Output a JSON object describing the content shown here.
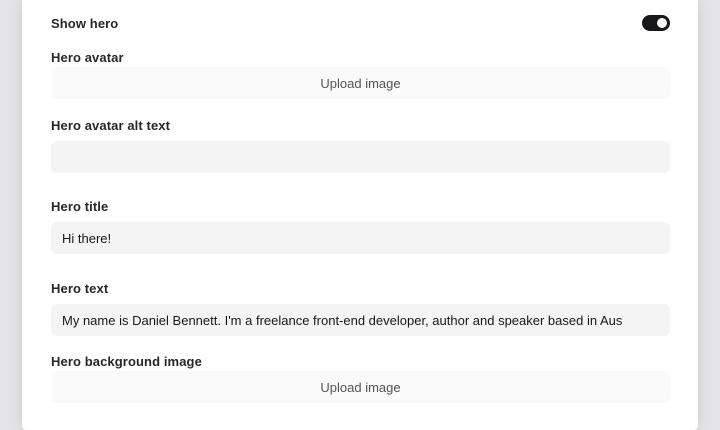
{
  "settings": {
    "show_hero": {
      "label": "Show hero",
      "enabled": true
    },
    "hero_avatar": {
      "label": "Hero avatar",
      "button_label": "Upload image"
    },
    "hero_avatar_alt": {
      "label": "Hero avatar alt text",
      "value": ""
    },
    "hero_title": {
      "label": "Hero title",
      "value": "Hi there!"
    },
    "hero_text": {
      "label": "Hero text",
      "value": "My name is Daniel Bennett. I'm a freelance front-end developer, author and speaker based in Aus"
    },
    "hero_background": {
      "label": "Hero background image",
      "button_label": "Upload image"
    }
  },
  "colors": {
    "toggle_on": "#18181b",
    "input_bg": "#f4f4f5",
    "upload_bg": "#fafafa"
  },
  "icons": {
    "toggle": "toggle-switch-on"
  }
}
